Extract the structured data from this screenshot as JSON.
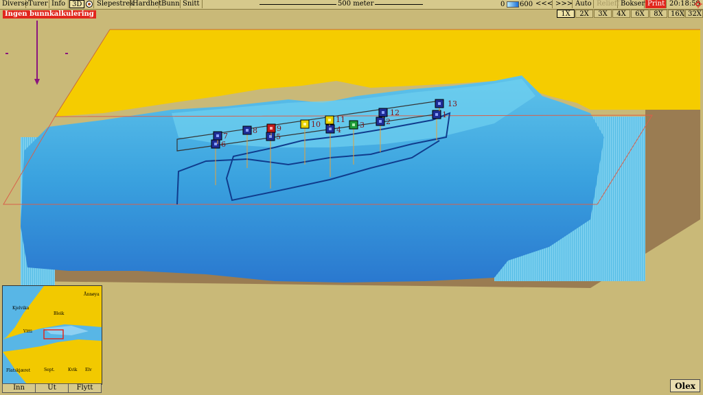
{
  "menu": [
    "Diverse",
    "Turer",
    "Info",
    "3D",
    "Slepestrek",
    "Hardhet",
    "Bunn",
    "Snitt"
  ],
  "menu_active": "3D",
  "scale_label": "500 meter",
  "depth": {
    "min": "0",
    "max": "600"
  },
  "nav": {
    "back": "<<<",
    "forward": ">>>",
    "auto": "Auto",
    "relieff": "Relieff",
    "bokser": "Bokser",
    "print": "Print",
    "time": "20:18:59"
  },
  "zoom": [
    "1X",
    "2X",
    "3X",
    "4X",
    "6X",
    "8X",
    "16X",
    "32X"
  ],
  "zoom_active": "1X",
  "alert": "Ingen bunnkalkulering",
  "markers": [
    "1",
    "2",
    "3",
    "4",
    "5",
    "6",
    "7",
    "8",
    "9",
    "10",
    "11",
    "12",
    "13"
  ],
  "minimap": {
    "places": [
      "Ånnøya",
      "Kjelvika",
      "Bleik",
      "Vitti",
      "Flatskjæret",
      "Sept.",
      "Kvik",
      "Elv"
    ],
    "buttons": [
      "Inn",
      "Ut",
      "Flytt"
    ]
  },
  "brand": "Olex"
}
